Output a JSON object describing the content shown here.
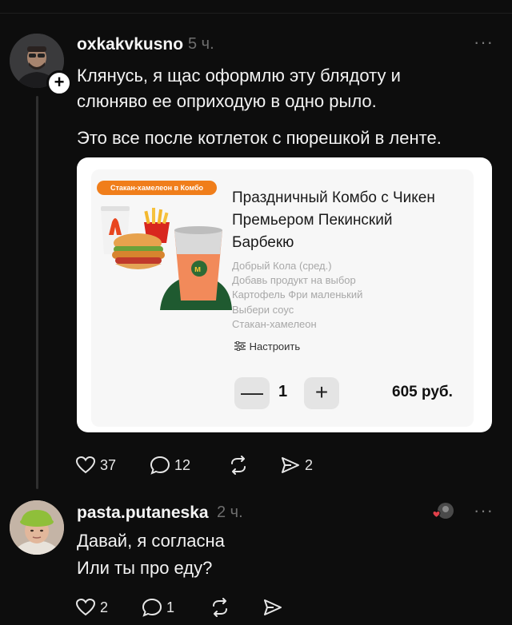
{
  "post": {
    "username": "oxkakvkusno",
    "time": "5 ч.",
    "more": "···",
    "text_line1": "Клянусь, я щас оформлю эту блядоту и",
    "text_line2": "слюняво ее оприходую в одно рыло.",
    "text_line3": "Это все после котлеток с пюрешкой в ленте.",
    "card": {
      "badge": "Стакан-хамелеон в Комбо",
      "title_lines": [
        "Праздничный Комбо с Чикен",
        "Премьером Пекинский",
        "Барбекю"
      ],
      "items": [
        "Добрый Кола (сред.)",
        "Добавь продукт на выбор",
        "Картофель Фри маленький",
        "Выбери соус",
        "Стакан-хамелеон"
      ],
      "customize_label": "Настроить",
      "minus_label": "—",
      "plus_label": "+",
      "quantity": "1",
      "price": "605 руб."
    },
    "likes": "37",
    "comments": "12",
    "shares": "2"
  },
  "reply": {
    "username": "pasta.putaneska",
    "time": "2 ч.",
    "more": "···",
    "text_line1": "Давай, я согласна",
    "text_line2": "Или ты про еду?",
    "likes": "2",
    "comments": "1"
  },
  "colors": {
    "background": "#0d0d0d",
    "badge": "#f07e1b",
    "like_dot": "#e0404a"
  }
}
